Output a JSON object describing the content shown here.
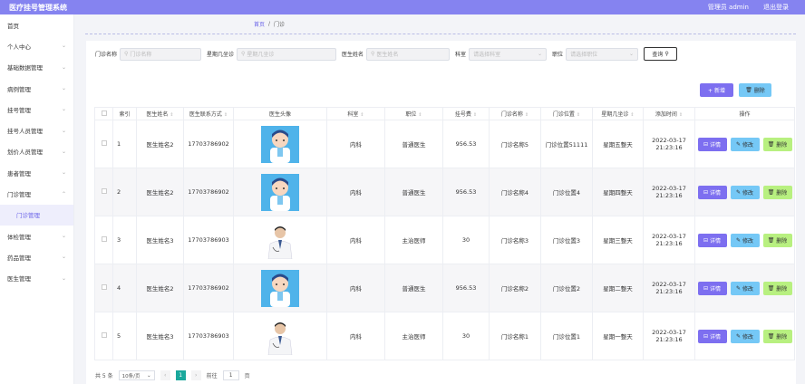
{
  "header": {
    "title": "医疗挂号管理系统",
    "user": "管理员 admin",
    "logout": "退出登录"
  },
  "sidebar": {
    "items": [
      {
        "label": "首页",
        "chev": ""
      },
      {
        "label": "个人中心",
        "chev": "⌄"
      },
      {
        "label": "基础数据管理",
        "chev": "⌄"
      },
      {
        "label": "病例管理",
        "chev": "⌄"
      },
      {
        "label": "挂号管理",
        "chev": "⌄"
      },
      {
        "label": "挂号人员管理",
        "chev": "⌄"
      },
      {
        "label": "划价人员管理",
        "chev": "⌄"
      },
      {
        "label": "患者管理",
        "chev": "⌄"
      },
      {
        "label": "门诊管理",
        "chev": "⌃"
      },
      {
        "label": "门诊管理",
        "chev": "",
        "sub": true
      },
      {
        "label": "体检管理",
        "chev": "⌄"
      },
      {
        "label": "药品管理",
        "chev": "⌄"
      },
      {
        "label": "医生管理",
        "chev": "⌄"
      }
    ]
  },
  "breadcrumb": {
    "home": "首页",
    "sep": "/",
    "current": "门诊"
  },
  "search": {
    "name_label": "门诊名称",
    "name_ph": "门诊名称",
    "week_label": "星期几坐诊",
    "week_ph": "星期几坐诊",
    "doctor_label": "医生姓名",
    "doctor_ph": "医生姓名",
    "dept_label": "科室",
    "dept_ph": "请选择科室",
    "title_label": "职位",
    "title_ph": "请选择职位",
    "query": "查询"
  },
  "actions": {
    "add": "+ 新增",
    "delete": "删除"
  },
  "table": {
    "headers": [
      "索引",
      "医生姓名",
      "医生联系方式",
      "医生头像",
      "科室",
      "职位",
      "挂号费",
      "门诊名称",
      "门诊位置",
      "星期几坐诊",
      "添加时间",
      "操作"
    ],
    "rows": [
      {
        "idx": "1",
        "name": "医生姓名2",
        "phone": "17703786902",
        "avatar": "cartoon",
        "dept": "内科",
        "title": "普通医生",
        "fee": "956.53",
        "clinic": "门诊名称5",
        "loc": "门诊位置51111",
        "week": "星期五整天",
        "time": "2022-03-17 21:23:16"
      },
      {
        "idx": "2",
        "name": "医生姓名2",
        "phone": "17703786902",
        "avatar": "cartoon",
        "dept": "内科",
        "title": "普通医生",
        "fee": "956.53",
        "clinic": "门诊名称4",
        "loc": "门诊位置4",
        "week": "星期四整天",
        "time": "2022-03-17 21:23:16"
      },
      {
        "idx": "3",
        "name": "医生姓名3",
        "phone": "17703786903",
        "avatar": "photo",
        "dept": "内科",
        "title": "主治医师",
        "fee": "30",
        "clinic": "门诊名称3",
        "loc": "门诊位置3",
        "week": "星期三整天",
        "time": "2022-03-17 21:23:16"
      },
      {
        "idx": "4",
        "name": "医生姓名2",
        "phone": "17703786902",
        "avatar": "cartoon",
        "dept": "内科",
        "title": "普通医生",
        "fee": "956.53",
        "clinic": "门诊名称2",
        "loc": "门诊位置2",
        "week": "星期二整天",
        "time": "2022-03-17 21:23:16"
      },
      {
        "idx": "5",
        "name": "医生姓名3",
        "phone": "17703786903",
        "avatar": "photo",
        "dept": "内科",
        "title": "主治医师",
        "fee": "30",
        "clinic": "门诊名称1",
        "loc": "门诊位置1",
        "week": "星期一整天",
        "time": "2022-03-17 21:23:16"
      }
    ],
    "ops": {
      "detail": "详情",
      "edit": "修改",
      "remove": "删除"
    }
  },
  "pagination": {
    "total": "共 5 条",
    "size": "10条/页",
    "current": "1",
    "goto": "前往",
    "goto_value": "1",
    "page_unit": "页"
  },
  "colors": {
    "accent": "#8583f0",
    "detail": "#7d6ff0",
    "edit": "#75c8f6",
    "remove": "#b8f080",
    "page": "#1aa89c"
  }
}
